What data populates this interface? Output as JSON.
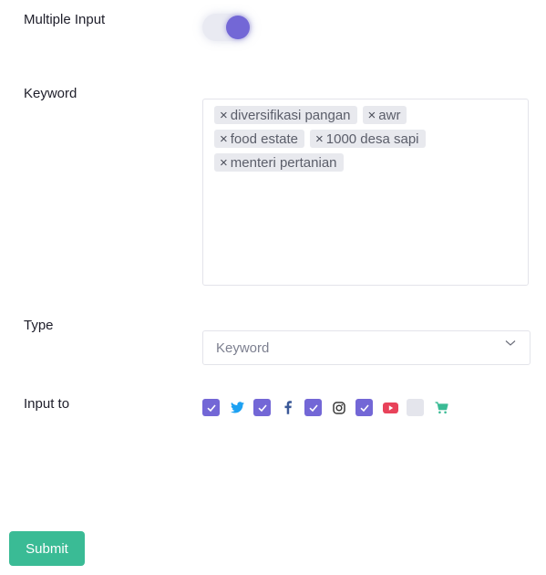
{
  "form": {
    "multiple_input_label": "Multiple Input",
    "multiple_input_on": true,
    "keyword_label": "Keyword",
    "keywords": [
      "diversifikasi pangan",
      "awr",
      "food estate",
      "1000 desa sapi",
      "menteri pertanian"
    ],
    "remove_glyph": "×",
    "type_label": "Type",
    "type_value": "Keyword",
    "input_to_label": "Input to",
    "sources": [
      {
        "name": "twitter",
        "icon": "twitter-icon",
        "checked": true,
        "color": "#1da1f2"
      },
      {
        "name": "facebook",
        "icon": "facebook-icon",
        "checked": true,
        "color": "#3b5998"
      },
      {
        "name": "instagram",
        "icon": "instagram-icon",
        "checked": true,
        "color": "#3a3a3a"
      },
      {
        "name": "youtube",
        "icon": "youtube-icon",
        "checked": true,
        "color": "#e8425a"
      },
      {
        "name": "marketplace",
        "icon": "cart-icon",
        "checked": false,
        "color": "#3abb95"
      }
    ],
    "submit_label": "Submit"
  },
  "colors": {
    "accent": "#7367d6",
    "success": "#3abb95"
  }
}
